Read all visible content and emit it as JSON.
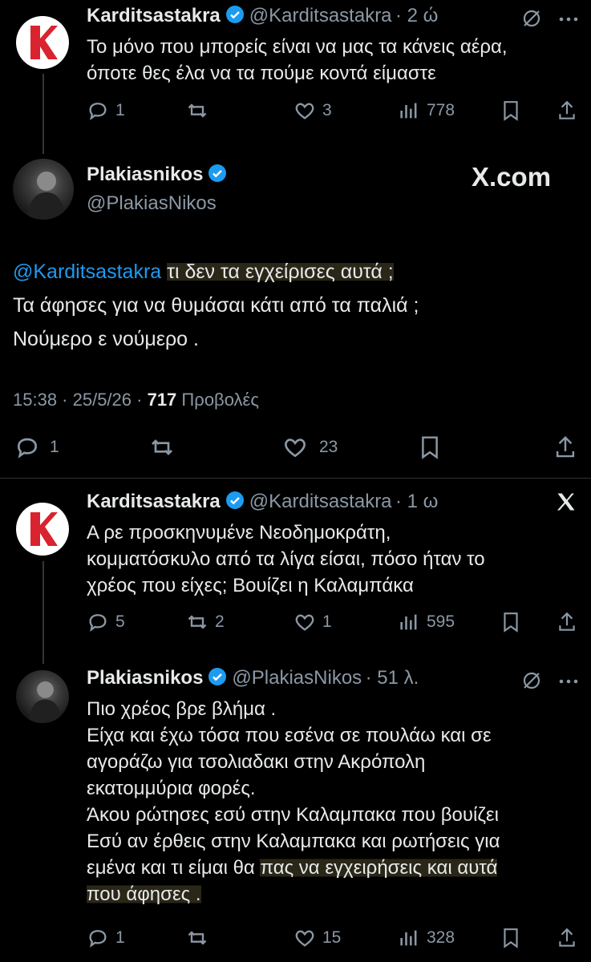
{
  "tweets": [
    {
      "name": "Karditsastakra",
      "handle": "@Karditsastakra",
      "time": "· 2 ώ",
      "lines": [
        "Το μόνο που μπορείς είναι να μας τα κάνεις αέρα,",
        "όποτε θες έλα να τα πούμε κοντά είμαστε"
      ],
      "replies": "1",
      "retweets": "",
      "likes": "3",
      "views": "778"
    },
    {
      "name": "Plakiasnikos",
      "handle": "@PlakiasNikos",
      "mention": "@Karditsastakra",
      "line1_rest": "τι δεν τα εγχείρισες αυτά ;",
      "line2": "Τα άφησες για να θυμάσαι κάτι από τα παλιά ;",
      "line3": "Νούμερο ε νούμερο .",
      "timestamp": "15:38 · 25/5/26 ·",
      "views_count": "717",
      "views_label": "Προβολές",
      "replies": "1",
      "retweets": "",
      "likes": "23",
      "brand": "X.com"
    },
    {
      "name": "Karditsastakra",
      "handle": "@Karditsastakra",
      "time": "· 1 ω",
      "lines": [
        "Α ρε προσκηνυμένε Νεοδημοκράτη,",
        "κομματόσκυλο από τα λίγα είσαι, πόσο ήταν το",
        "χρέος που είχες; Βουίζει η Καλαμπάκα"
      ],
      "replies": "5",
      "retweets": "2",
      "likes": "1",
      "views": "595"
    },
    {
      "name": "Plakiasnikos",
      "handle": "@PlakiasNikos",
      "time": "· 51 λ.",
      "lines": [
        "Πιο χρέος βρε βλήμα .",
        "Είχα και  έχω τόσα που εσένα σε πουλάω και σε",
        "αγοράζω για τσολιαδακι στην Ακρόπολη",
        "εκατομμύρια φορές.",
        "Άκου ρώτησες εσύ στην Καλαμπακα που βουίζει",
        "Εσύ αν έρθεις στην Καλαμπακα και ρωτήσεις για",
        "εμένα και τι είμαι θα",
        "πας να εγχειρήσεις και αυτά",
        "που άφησες ."
      ],
      "replies": "1",
      "retweets": "",
      "likes": "15",
      "views": "328"
    }
  ],
  "colors": {
    "accent": "#1d9bf0",
    "muted": "#8b98a5",
    "text": "#e7e9ea",
    "logo_red": "#d9232e"
  }
}
